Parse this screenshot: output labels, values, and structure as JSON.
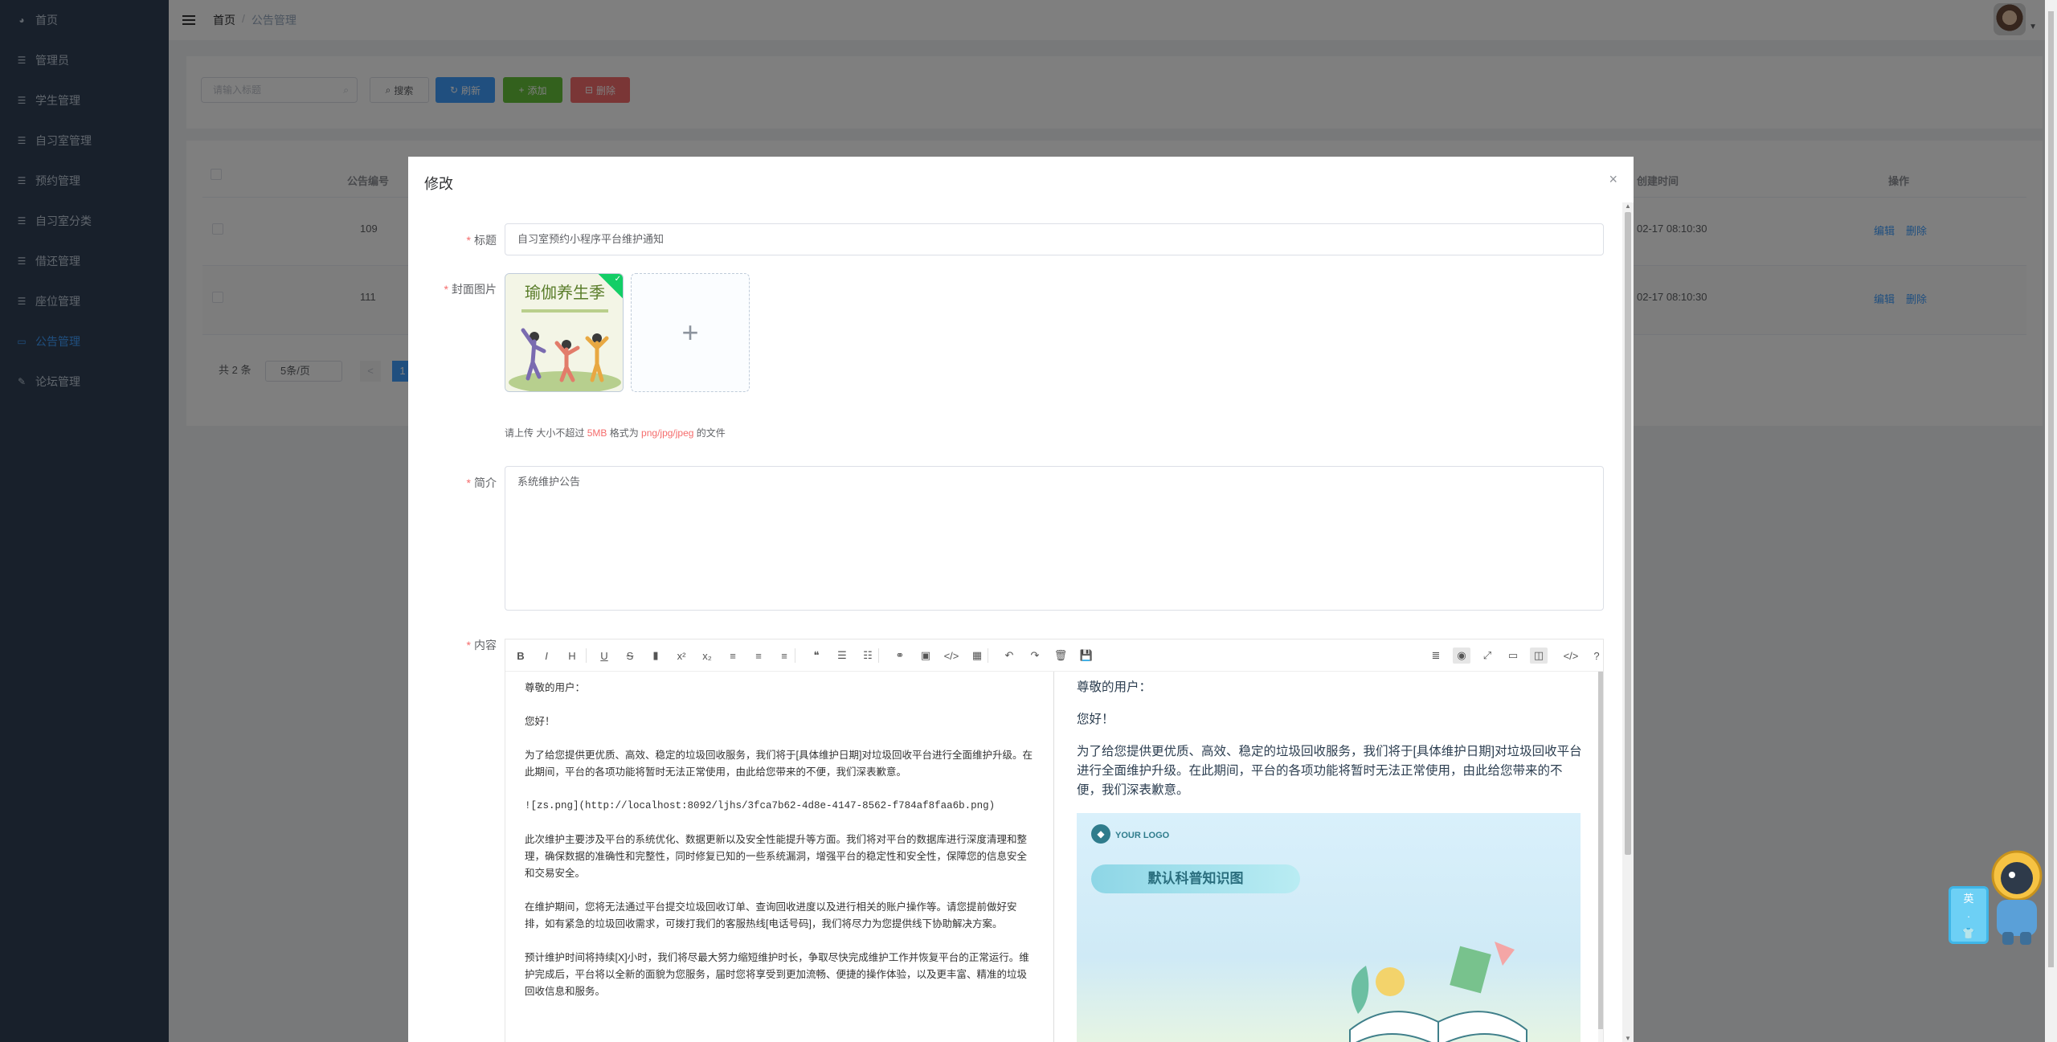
{
  "sidebar": {
    "items": [
      {
        "label": "首页",
        "icon": "dashboard-icon"
      },
      {
        "label": "管理员",
        "icon": "list-icon"
      },
      {
        "label": "学生管理",
        "icon": "list-icon"
      },
      {
        "label": "自习室管理",
        "icon": "list-icon"
      },
      {
        "label": "预约管理",
        "icon": "list-icon"
      },
      {
        "label": "自习室分类",
        "icon": "list-icon"
      },
      {
        "label": "借还管理",
        "icon": "list-icon"
      },
      {
        "label": "座位管理",
        "icon": "list-icon"
      },
      {
        "label": "公告管理",
        "icon": "folder-icon",
        "active": true
      },
      {
        "label": "论坛管理",
        "icon": "edit-icon"
      }
    ],
    "bg_color": "#304156",
    "active_color": "#409eff"
  },
  "header": {
    "breadcrumb": {
      "home": "首页",
      "sep": "/",
      "current": "公告管理"
    }
  },
  "toolbar": {
    "search_placeholder": "请输入标题",
    "search_label": "搜索",
    "refresh_label": "刷新",
    "add_label": "添加",
    "delete_label": "删除"
  },
  "table": {
    "columns": {
      "id": "公告编号",
      "created": "创建时间",
      "actions": "操作"
    },
    "rows": [
      {
        "id": "109",
        "created": "02-17 08:10:30",
        "edit": "编辑",
        "delete": "删除"
      },
      {
        "id": "111",
        "created": "02-17 08:10:30",
        "edit": "编辑",
        "delete": "删除"
      }
    ],
    "pager": {
      "total": "共 2 条",
      "page_size": "5条/页",
      "prev": "<",
      "page": "1"
    }
  },
  "dialog": {
    "title": "修改",
    "close": "×",
    "fields": {
      "title_label": "标题",
      "title_value": "自习室预约小程序平台维护通知",
      "cover_label": "封面图片",
      "cover_image_text": "瑜伽养生季",
      "upload_plus": "+",
      "upload_tip": {
        "prefix": "请上传",
        "size_prefix": " 大小不超过 ",
        "size": "5MB",
        "format_prefix": " 格式为 ",
        "format": "png/jpg/jpeg",
        "suffix": " 的文件"
      },
      "summary_label": "简介",
      "summary_value": "系统维护公告",
      "content_label": "内容"
    },
    "editor": {
      "toolbar_left": [
        {
          "glyph": "B",
          "icon": "bold-icon"
        },
        {
          "glyph": "I",
          "icon": "italic-icon"
        },
        {
          "glyph": "H",
          "icon": "heading-icon"
        },
        {
          "glyph": "U",
          "icon": "underline-icon"
        },
        {
          "glyph": "S",
          "icon": "strikethrough-icon"
        },
        {
          "glyph": "▮",
          "icon": "mark-icon"
        },
        {
          "glyph": "x²",
          "icon": "superscript-icon"
        },
        {
          "glyph": "x₂",
          "icon": "subscript-icon"
        },
        {
          "glyph": "≡",
          "icon": "align-left-icon"
        },
        {
          "glyph": "≡",
          "icon": "align-center-icon"
        },
        {
          "glyph": "≡",
          "icon": "align-right-icon"
        },
        {
          "glyph": "❝",
          "icon": "quote-icon"
        },
        {
          "glyph": "☰",
          "icon": "ordered-list-icon"
        },
        {
          "glyph": "☷",
          "icon": "unordered-list-icon"
        },
        {
          "glyph": "⚭",
          "icon": "link-icon"
        },
        {
          "glyph": "▣",
          "icon": "image-icon"
        },
        {
          "glyph": "</>",
          "icon": "code-icon"
        },
        {
          "glyph": "▦",
          "icon": "table-icon"
        },
        {
          "glyph": "↶",
          "icon": "undo-icon"
        },
        {
          "glyph": "↷",
          "icon": "redo-icon"
        },
        {
          "glyph": "🗑",
          "icon": "trash-icon"
        },
        {
          "glyph": "💾",
          "icon": "save-icon"
        }
      ],
      "toolbar_right": [
        {
          "glyph": "≣",
          "icon": "navigation-icon"
        },
        {
          "glyph": "◉",
          "icon": "preview-toggle-icon",
          "on": true
        },
        {
          "glyph": "⤢",
          "icon": "fullscreen-icon"
        },
        {
          "glyph": "▭",
          "icon": "read-mode-icon"
        },
        {
          "glyph": "◫",
          "icon": "subfield-icon",
          "on": true
        },
        {
          "glyph": "</>",
          "icon": "html-code-icon"
        },
        {
          "glyph": "?",
          "icon": "help-icon"
        }
      ],
      "source_lines": [
        "尊敬的用户：",
        "您好！",
        "为了给您提供更优质、高效、稳定的垃圾回收服务，我们将于[具体维护日期]对垃圾回收平台进行全面维护升级。在此期间，平台的各项功能将暂时无法正常使用，由此给您带来的不便，我们深表歉意。",
        "![zs.png](http://localhost:8092/ljhs/3fca7b62-4d8e-4147-8562-f784af8faa6b.png)",
        "此次维护主要涉及平台的系统优化、数据更新以及安全性能提升等方面。我们将对平台的数据库进行深度清理和整理，确保数据的准确性和完整性，同时修复已知的一些系统漏洞，增强平台的稳定性和安全性，保障您的信息安全和交易安全。",
        "在维护期间，您将无法通过平台提交垃圾回收订单、查询回收进度以及进行相关的账户操作等。请您提前做好安排，如有紧急的垃圾回收需求，可拨打我们的客服热线[电话号码]，我们将尽力为您提供线下协助解决方案。",
        "预计维护时间将持续[X]小时，我们将尽最大努力缩短维护时长，争取尽快完成维护工作并恢复平台的正常运行。维护完成后，平台将以全新的面貌为您服务，届时您将享受到更加流畅、便捷的操作体验，以及更丰富、精准的垃圾回收信息和服务。"
      ],
      "preview_lines": [
        "尊敬的用户：",
        "您好！",
        "为了给您提供更优质、高效、稳定的垃圾回收服务，我们将于[具体维护日期]对垃圾回收平台进行全面维护升级。在此期间，平台的各项功能将暂时无法正常使用，由此给您带来的不便，我们深表歉意。"
      ],
      "preview_image": {
        "logo_text": "YOUR LOGO",
        "banner": "默认科普知识图"
      }
    }
  },
  "float_widget": {
    "chars": [
      "英",
      "·",
      "👕"
    ]
  }
}
